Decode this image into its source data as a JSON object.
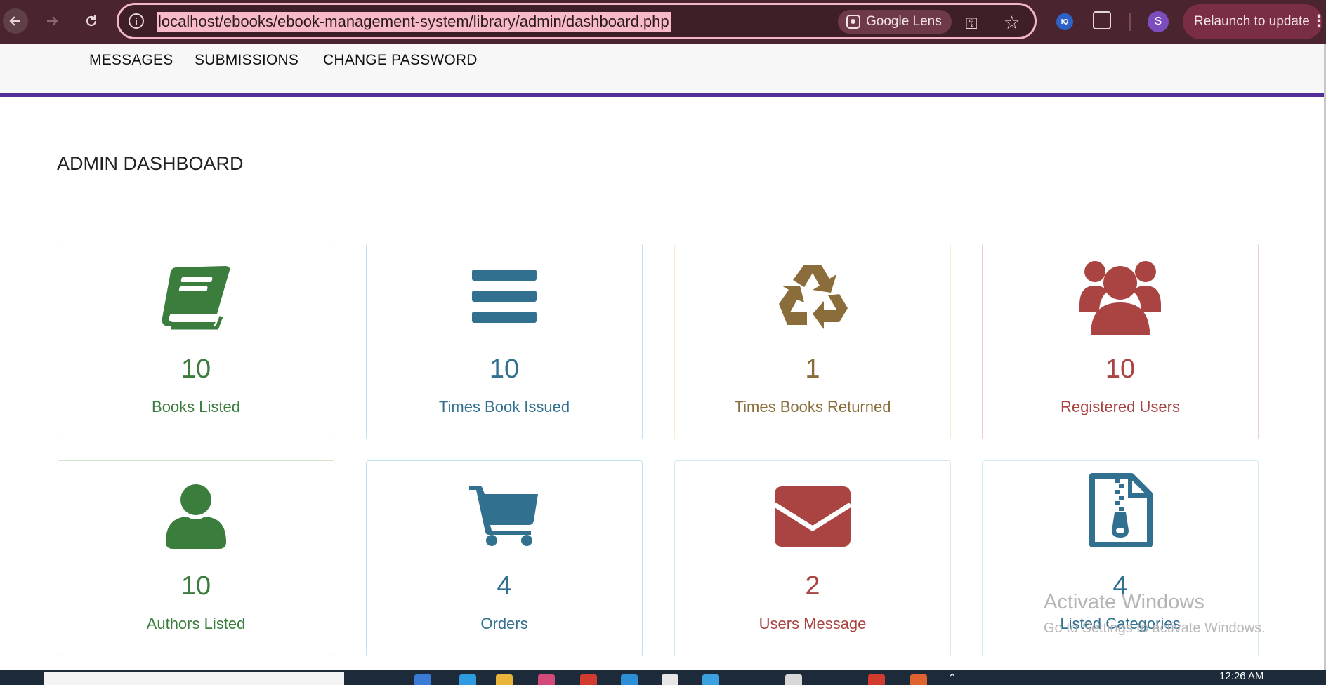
{
  "browser": {
    "url": "localhost/ebooks/ebook-management-system/library/admin/dashboard.php",
    "lens_label": "Google Lens",
    "profile_initial": "S",
    "relaunch_label": "Relaunch to update",
    "ext_label": "IQ"
  },
  "nav": {
    "items": [
      "MESSAGES",
      "SUBMISSIONS",
      "CHANGE PASSWORD"
    ]
  },
  "page": {
    "title": "ADMIN DASHBOARD"
  },
  "cards": [
    {
      "count": "10",
      "label": "Books Listed",
      "icon": "book-icon",
      "color": "#3a7d3c"
    },
    {
      "count": "10",
      "label": "Times Book Issued",
      "icon": "bars-icon",
      "color": "#31708f"
    },
    {
      "count": "1",
      "label": "Times Books Returned",
      "icon": "recycle-icon",
      "color": "#8a6d3b"
    },
    {
      "count": "10",
      "label": "Registered Users",
      "icon": "users-icon",
      "color": "#a94442"
    },
    {
      "count": "10",
      "label": "Authors Listed",
      "icon": "user-icon",
      "color": "#3a7d3c"
    },
    {
      "count": "4",
      "label": "Orders",
      "icon": "cart-icon",
      "color": "#31708f"
    },
    {
      "count": "2",
      "label": "Users Message",
      "icon": "envelope-icon",
      "color": "#a94442"
    },
    {
      "count": "4",
      "label": "Listed Categories",
      "icon": "zip-file-icon",
      "color": "#31708f"
    }
  ],
  "watermark": {
    "title": "Activate Windows",
    "subtitle": "Go to Settings to activate Windows."
  },
  "taskbar": {
    "clock": "12:26 AM"
  }
}
